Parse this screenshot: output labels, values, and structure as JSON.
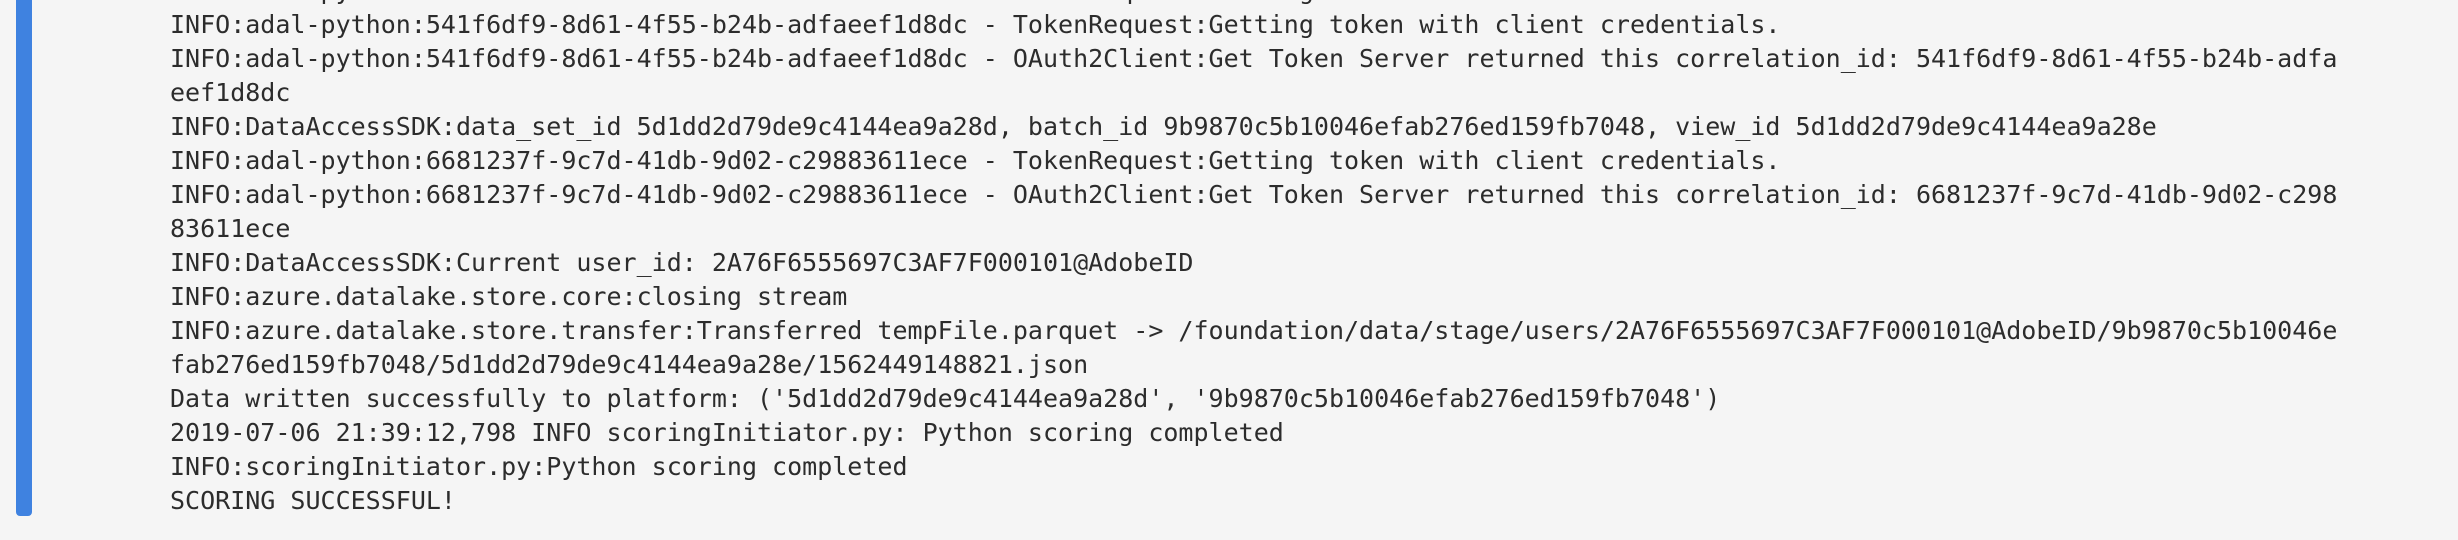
{
  "colors": {
    "background": "#f5f5f5",
    "accent": "#3f82e0",
    "text": "#2c2c2c"
  },
  "partial_top_line": "INFO:adal-python:541f6df9-8d61-4f55-b24b-adfaeef1d8dc - TokenRequest:Getting token with client credentials.",
  "log_lines": [
    "INFO:adal-python:541f6df9-8d61-4f55-b24b-adfaeef1d8dc - TokenRequest:Getting token with client credentials.",
    "INFO:adal-python:541f6df9-8d61-4f55-b24b-adfaeef1d8dc - OAuth2Client:Get Token Server returned this correlation_id: 541f6df9-8d61-4f55-b24b-adfa",
    "eef1d8dc",
    "INFO:DataAccessSDK:data_set_id 5d1dd2d79de9c4144ea9a28d, batch_id 9b9870c5b10046efab276ed159fb7048, view_id 5d1dd2d79de9c4144ea9a28e",
    "INFO:adal-python:6681237f-9c7d-41db-9d02-c29883611ece - TokenRequest:Getting token with client credentials.",
    "INFO:adal-python:6681237f-9c7d-41db-9d02-c29883611ece - OAuth2Client:Get Token Server returned this correlation_id: 6681237f-9c7d-41db-9d02-c298",
    "83611ece",
    "INFO:DataAccessSDK:Current user_id: 2A76F6555697C3AF7F000101@AdobeID",
    "INFO:azure.datalake.store.core:closing stream",
    "INFO:azure.datalake.store.transfer:Transferred tempFile.parquet -> /foundation/data/stage/users/2A76F6555697C3AF7F000101@AdobeID/9b9870c5b10046e",
    "fab276ed159fb7048/5d1dd2d79de9c4144ea9a28e/1562449148821.json",
    "Data written successfully to platform: ('5d1dd2d79de9c4144ea9a28d', '9b9870c5b10046efab276ed159fb7048')",
    "2019-07-06 21:39:12,798 INFO scoringInitiator.py: Python scoring completed",
    "INFO:scoringInitiator.py:Python scoring completed",
    "SCORING SUCCESSFUL!"
  ]
}
